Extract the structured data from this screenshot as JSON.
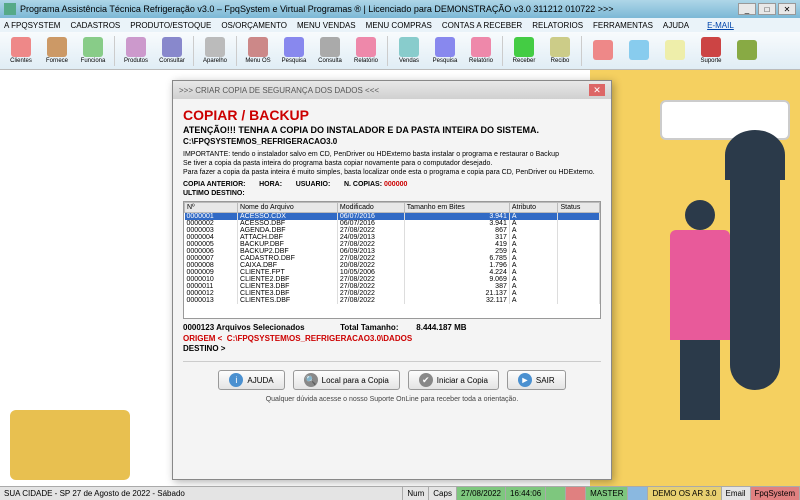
{
  "titlebar": "Programa Assistência Técnica Refrigeração v3.0 – FpqSystem e Virtual Programas ® | Licenciado para  DEMONSTRAÇÃO v3.0 311212 010722 >>>",
  "menu": {
    "items": [
      "A FPQSYSTEM",
      "CADASTROS",
      "PRODUTO/ESTOQUE",
      "OS/ORÇAMENTO",
      "MENU VENDAS",
      "MENU COMPRAS",
      "CONTAS A RECEBER",
      "RELATORIOS",
      "FERRAMENTAS",
      "AJUDA"
    ],
    "email": "E-MAIL"
  },
  "toolbar": [
    {
      "lbl": "Clientes",
      "c": "#e88"
    },
    {
      "lbl": "Fornece",
      "c": "#c96"
    },
    {
      "lbl": "Funciona",
      "c": "#8c8"
    },
    {
      "lbl": "Produtos",
      "c": "#c9c"
    },
    {
      "lbl": "Consultar",
      "c": "#88c"
    },
    {
      "lbl": "Aparelho",
      "c": "#bbb"
    },
    {
      "lbl": "Menu OS",
      "c": "#c88"
    },
    {
      "lbl": "Pesquisa",
      "c": "#88e"
    },
    {
      "lbl": "Consulta",
      "c": "#aaa"
    },
    {
      "lbl": "Relatório",
      "c": "#e8a"
    },
    {
      "lbl": "Vendas",
      "c": "#8cc"
    },
    {
      "lbl": "Pesquisa",
      "c": "#88e"
    },
    {
      "lbl": "Relatório",
      "c": "#e8a"
    },
    {
      "lbl": "Receber",
      "c": "#4c4"
    },
    {
      "lbl": "Recibo",
      "c": "#cc8"
    },
    {
      "lbl": "",
      "c": "#e88"
    },
    {
      "lbl": "",
      "c": "#8ce"
    },
    {
      "lbl": "",
      "c": "#eea"
    },
    {
      "lbl": "Suporte",
      "c": "#c44"
    },
    {
      "lbl": "",
      "c": "#8a4"
    }
  ],
  "dialog": {
    "title": ">>> CRIAR COPIA DE SEGURANÇA DOS DADOS <<<",
    "h1": "COPIAR / BACKUP",
    "attn": "ATENÇÃO!!!  TENHA A COPIA DO INSTALADOR E DA PASTA INTEIRA DO SISTEMA.",
    "path": "C:\\FPQSYSTEM\\OS_REFRIGERACAO3.0",
    "imp1": "IMPORTANTE: tendo o instalador salvo em CD, PenDriver ou HDExterno basta instalar o programa e restaurar o Backup",
    "imp2": "Se tiver a copia da pasta inteira do programa basta copiar novamente para o computador desejado.",
    "imp3": "Para fazer a copia da pasta inteira é muito simples, basta localizar onde esta o programa e copia para CD, PenDriver ou HDExterno.",
    "labels": {
      "copia": "COPIA ANTERIOR:",
      "hora": "HORA:",
      "usuario": "USUARIO:",
      "ncopias": "N. COPIAS:",
      "ultimo": "ULTIMO DESTINO:"
    },
    "ncopias_val": "000000",
    "grid_headers": [
      "Nº",
      "Nome do Arquivo",
      "Modificado",
      "Tamanho em Bites",
      "Atributo",
      "Status"
    ],
    "rows": [
      [
        "0000001",
        "ACESSO.CDX",
        "06/07/2016",
        "3.941",
        "A",
        ""
      ],
      [
        "0000002",
        "ACESSO.DBF",
        "06/07/2016",
        "3.941",
        "A",
        ""
      ],
      [
        "0000003",
        "AGENDA.DBF",
        "27/08/2022",
        "867",
        "A",
        ""
      ],
      [
        "0000004",
        "ATTACH.DBF",
        "24/09/2013",
        "317",
        "A",
        ""
      ],
      [
        "0000005",
        "BACKUP.DBF",
        "27/08/2022",
        "419",
        "A",
        ""
      ],
      [
        "0000006",
        "BACKUP2.DBF",
        "06/09/2013",
        "259",
        "A",
        ""
      ],
      [
        "0000007",
        "CADASTRO.DBF",
        "27/08/2022",
        "6.785",
        "A",
        ""
      ],
      [
        "0000008",
        "CAIXA.DBF",
        "20/08/2022",
        "1.796",
        "A",
        ""
      ],
      [
        "0000009",
        "CLIENTE.FPT",
        "10/05/2006",
        "4.224",
        "A",
        ""
      ],
      [
        "0000010",
        "CLIENTE2.DBF",
        "27/08/2022",
        "9.069",
        "A",
        ""
      ],
      [
        "0000011",
        "CLIENTE3.DBF",
        "27/08/2022",
        "387",
        "A",
        ""
      ],
      [
        "0000012",
        "CLIENTE3.DBF",
        "27/08/2022",
        "21.137",
        "A",
        ""
      ],
      [
        "0000013",
        "CLIENTES.DBF",
        "27/08/2022",
        "32.117",
        "A",
        ""
      ]
    ],
    "footer_count": "0000123 Arquivos Selecionados",
    "footer_total_lbl": "Total Tamanho:",
    "footer_total_val": "8.444.187 MB",
    "origin_lbl": "ORIGEM <",
    "origin_val": "C:\\FPQSYSTEM\\OS_REFRIGERACAO3.0\\DADOS",
    "dest_lbl": "DESTINO >",
    "btns": {
      "ajuda": "AJUDA",
      "local": "Local para a Copia",
      "iniciar": "Iniciar a Copia",
      "sair": "SAIR"
    },
    "fine": "Qualquer dúvida acesse o nosso Suporte OnLine para receber toda a orientação."
  },
  "status": {
    "left": "SUA CIDADE - SP 27 de Agosto de 2022 - Sábado",
    "num": "Num",
    "caps": "Caps",
    "date": "27/08/2022",
    "time": "16:44:06",
    "demo": "DEMO OS AR 3.0",
    "master": "MASTER",
    "email": "Email",
    "fpq": "FpqSystem"
  }
}
